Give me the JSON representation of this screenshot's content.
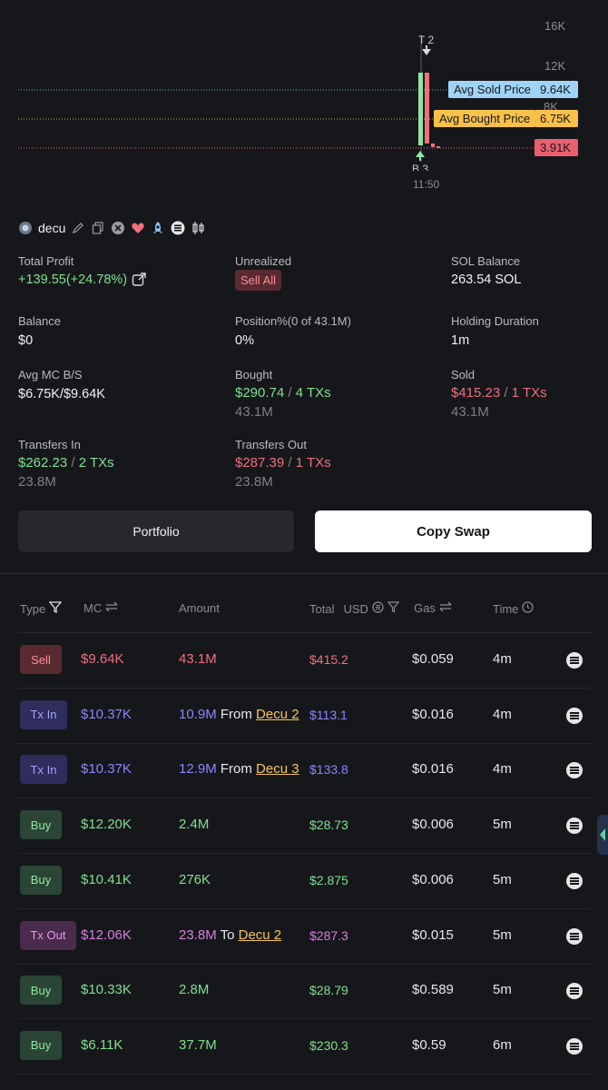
{
  "chart": {
    "ticks": [
      "16K",
      "12K",
      "8K"
    ],
    "avg_sold_label": "Avg Sold Price",
    "avg_sold_value": "9.64K",
    "avg_bought_label": "Avg Bought Price",
    "avg_bought_value": "6.75K",
    "current_value": "3.91K",
    "marker_top": "T 2",
    "marker_bottom": "B 3",
    "time_label": "11:50",
    "colors": {
      "sold": "#9fd4f7",
      "bought": "#f7c14a",
      "current": "#e8606f"
    }
  },
  "token": {
    "name": "decu"
  },
  "stats": {
    "total_profit_label": "Total Profit",
    "total_profit_value": "+139.55(+24.78%)",
    "unrealized_label": "Unrealized",
    "sell_all": "Sell All",
    "sol_balance_label": "SOL Balance",
    "sol_balance_value": "263.54 SOL",
    "balance_label": "Balance",
    "balance_value": "$0",
    "position_label": "Position%(0 of 43.1M)",
    "position_value": "0%",
    "holding_label": "Holding Duration",
    "holding_value": "1m",
    "avgmc_label": "Avg MC B/S",
    "avgmc_value": "$6.75K/$9.64K",
    "bought_label": "Bought",
    "bought_usd": "$290.74",
    "bought_txs": "4 TXs",
    "bought_amount": "43.1M",
    "sold_label": "Sold",
    "sold_usd": "$415.23",
    "sold_txs": "1 TXs",
    "sold_amount": "43.1M",
    "tin_label": "Transfers In",
    "tin_usd": "$262.23",
    "tin_txs": "2 TXs",
    "tin_amount": "23.8M",
    "tout_label": "Transfers Out",
    "tout_usd": "$287.39",
    "tout_txs": "1 TXs",
    "tout_amount": "23.8M",
    "slash": "/"
  },
  "buttons": {
    "portfolio": "Portfolio",
    "copy_swap": "Copy Swap"
  },
  "table": {
    "headers": {
      "type": "Type",
      "mc": "MC",
      "amount": "Amount",
      "total": "Total",
      "usd": "USD",
      "gas": "Gas",
      "time": "Time"
    },
    "rows": [
      {
        "type": "Sell",
        "mc": "$9.64K",
        "amount": "43.1M",
        "mid": "",
        "counterparty": "",
        "total": "$415.2",
        "gas": "$0.059",
        "time": "4m"
      },
      {
        "type": "Tx In",
        "mc": "$10.37K",
        "amount": "10.9M",
        "mid": "From",
        "counterparty": "Decu 2",
        "total": "$113.1",
        "gas": "$0.016",
        "time": "4m"
      },
      {
        "type": "Tx In",
        "mc": "$10.37K",
        "amount": "12.9M",
        "mid": "From",
        "counterparty": "Decu 3",
        "total": "$133.8",
        "gas": "$0.016",
        "time": "4m"
      },
      {
        "type": "Buy",
        "mc": "$12.20K",
        "amount": "2.4M",
        "mid": "",
        "counterparty": "",
        "total": "$28.73",
        "gas": "$0.006",
        "time": "5m"
      },
      {
        "type": "Buy",
        "mc": "$10.41K",
        "amount": "276K",
        "mid": "",
        "counterparty": "",
        "total": "$2.875",
        "gas": "$0.006",
        "time": "5m"
      },
      {
        "type": "Tx Out",
        "mc": "$12.06K",
        "amount": "23.8M",
        "mid": "To",
        "counterparty": "Decu 2",
        "total": "$287.3",
        "gas": "$0.015",
        "time": "5m"
      },
      {
        "type": "Buy",
        "mc": "$10.33K",
        "amount": "2.8M",
        "mid": "",
        "counterparty": "",
        "total": "$28.79",
        "gas": "$0.589",
        "time": "5m"
      },
      {
        "type": "Buy",
        "mc": "$6.11K",
        "amount": "37.7M",
        "mid": "",
        "counterparty": "",
        "total": "$230.3",
        "gas": "$0.59",
        "time": "6m"
      }
    ]
  }
}
